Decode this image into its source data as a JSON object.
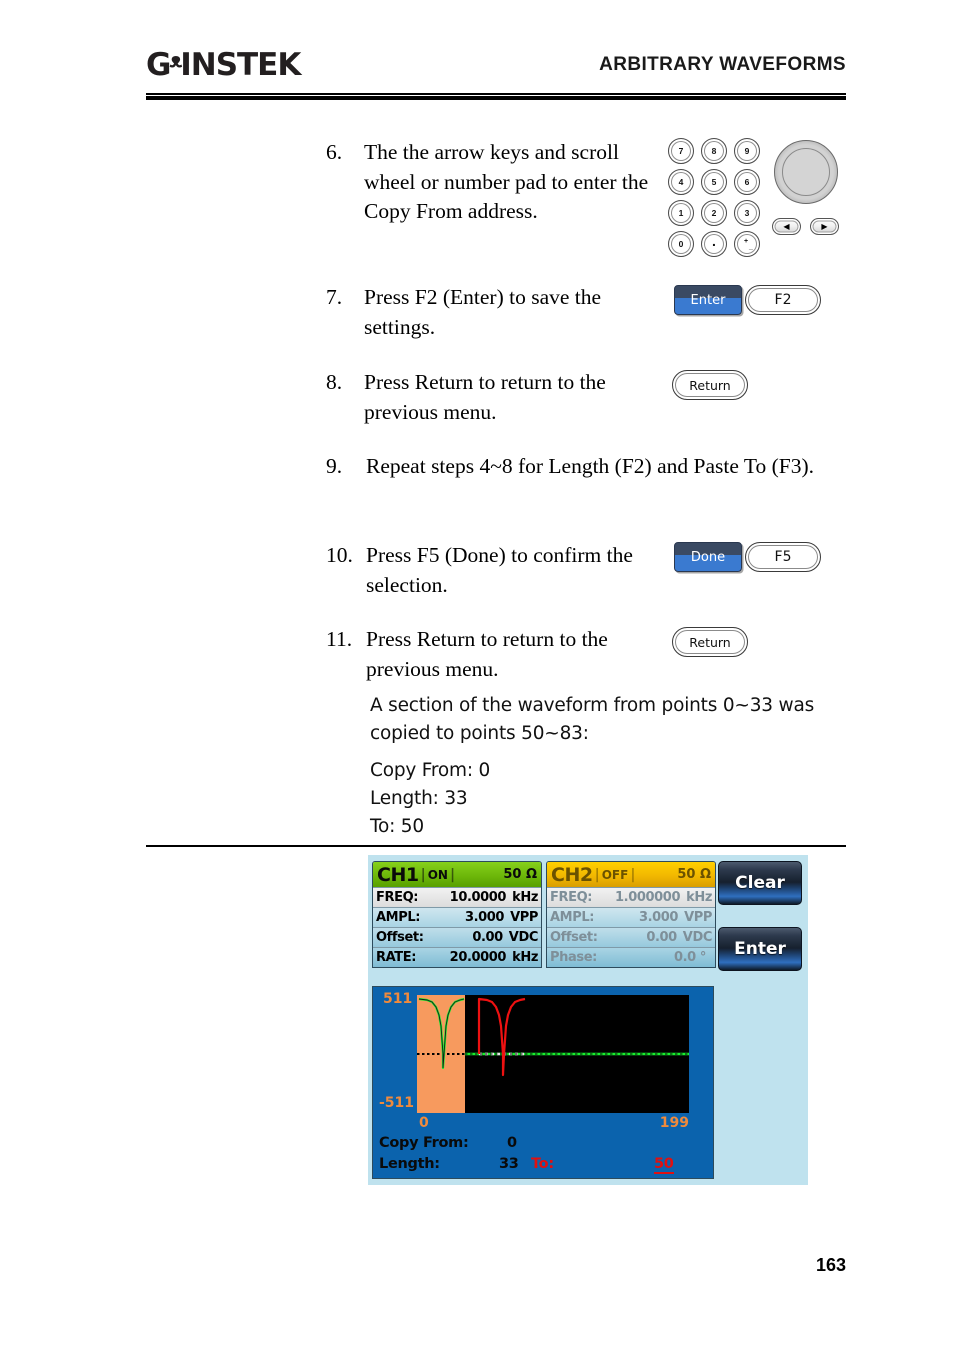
{
  "header": {
    "logo_gw": "Gᵜ",
    "logo_instek": "INSTEK",
    "title": "ARBITRARY WAVEFORMS"
  },
  "steps": [
    {
      "num": "6.",
      "text": "The the arrow keys and scroll wheel or number pad to enter the Copy From address."
    },
    {
      "num": "7.",
      "text": "Press F2 (Enter) to save the settings."
    },
    {
      "num": "8.",
      "text": "Press Return to return to the previous menu."
    },
    {
      "num": "9.",
      "text": "Repeat steps 4~8 for Length (F2) and Paste To (F3)."
    },
    {
      "num": "10.",
      "text": "Press F5 (Done) to confirm the selection."
    },
    {
      "num": "11.",
      "text": "Press Return to return to the previous menu."
    }
  ],
  "note": {
    "description": "A section of the waveform from points 0~33 was copied to points 50~83:",
    "copy_from": "Copy From: 0",
    "length": "Length: 33",
    "to": "To: 50"
  },
  "keypad": {
    "rows": [
      [
        "7",
        "8",
        "9"
      ],
      [
        "4",
        "5",
        "6"
      ],
      [
        "1",
        "2",
        "3"
      ],
      [
        "0",
        ".",
        "+/-"
      ]
    ]
  },
  "arrows": {
    "left": "◀",
    "right": "▶"
  },
  "keys": {
    "enter_softkey": "Enter",
    "f2": "F2",
    "return_8": "Return",
    "done_softkey": "Done",
    "f5": "F5",
    "return_11": "Return"
  },
  "instrument": {
    "ch1": {
      "name": "CH1",
      "state": "ON",
      "impedance": "50 Ω",
      "rows": [
        {
          "label": "FREQ:",
          "value": "10.0000",
          "unit": "kHz"
        },
        {
          "label": "AMPL:",
          "value": "3.000",
          "unit": "VPP"
        },
        {
          "label": "Offset:",
          "value": "0.00",
          "unit": "VDC"
        },
        {
          "label": "RATE:",
          "value": "20.0000",
          "unit": "kHz"
        }
      ]
    },
    "ch2": {
      "name": "CH2",
      "state": "OFF",
      "impedance": "50 Ω",
      "rows": [
        {
          "label": "FREQ:",
          "value": "1.000000",
          "unit": "kHz"
        },
        {
          "label": "AMPL:",
          "value": "3.000",
          "unit": "VPP"
        },
        {
          "label": "Offset:",
          "value": "0.00",
          "unit": "VDC"
        },
        {
          "label": "Phase:",
          "value": "0.0 °",
          "unit": ""
        }
      ]
    },
    "side_buttons": {
      "clear": "Clear",
      "enter": "Enter"
    },
    "plot": {
      "y_max": "511",
      "y_min": "-511",
      "x_min": "0",
      "x_max": "199",
      "highlight_start": 0,
      "highlight_end": 33,
      "colors": {
        "source_trace": "#18ef2e",
        "pasted_trace": "#ee1111",
        "highlight": "#f79a5e",
        "plot_background": "#000000",
        "screen_background": "#0b63ad",
        "axis_text": "#f08a3c"
      }
    },
    "status": {
      "copy_from_label": "Copy From:",
      "copy_from_value": "0",
      "length_label": "Length:",
      "length_value": "33",
      "to_label": "To:",
      "to_value": "50"
    }
  },
  "footer": {
    "page": "163"
  }
}
